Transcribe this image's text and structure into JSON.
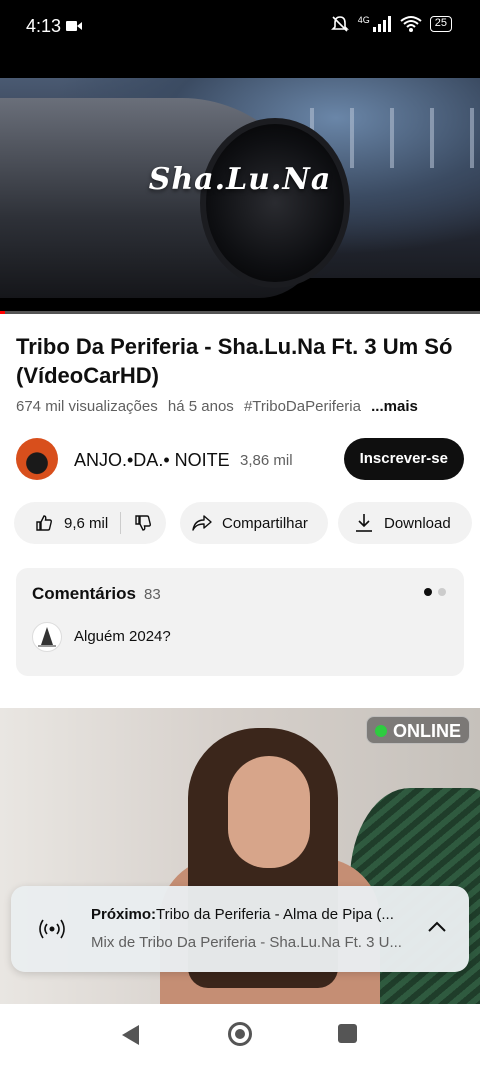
{
  "status_bar": {
    "time": "4:13",
    "network": "4G",
    "battery": "25"
  },
  "video": {
    "overlay_title": "Sha.Lu.Na",
    "progress": 0.01
  },
  "details": {
    "title": "Tribo Da Periferia - Sha.Lu.Na Ft. 3 Um Só  (VídeoCarHD)",
    "views": "674 mil visualizações",
    "age": "há 5 anos",
    "hashtag": "#TriboDaPeriferia",
    "more": "...mais"
  },
  "channel": {
    "name": "ANJO.•DA.• NOITE",
    "subscribers": "3,86 mil",
    "subscribe_label": "Inscrever-se"
  },
  "actions": {
    "likes": "9,6 mil",
    "share": "Compartilhar",
    "download": "Download"
  },
  "comments": {
    "title": "Comentários",
    "count": "83",
    "top_comment": "Alguém 2024?"
  },
  "ad": {
    "badge": "ONLINE"
  },
  "up_next": {
    "label": "Próximo:",
    "title": "Tribo da Periferia - Alma de Pipa (...",
    "subtitle": "Mix de Tribo Da Periferia - Sha.Lu.Na Ft. 3 U..."
  },
  "colors": {
    "accent": "#ff0000",
    "subscribe_bg": "#0f0f0f",
    "online_dot": "#2ecc40"
  }
}
